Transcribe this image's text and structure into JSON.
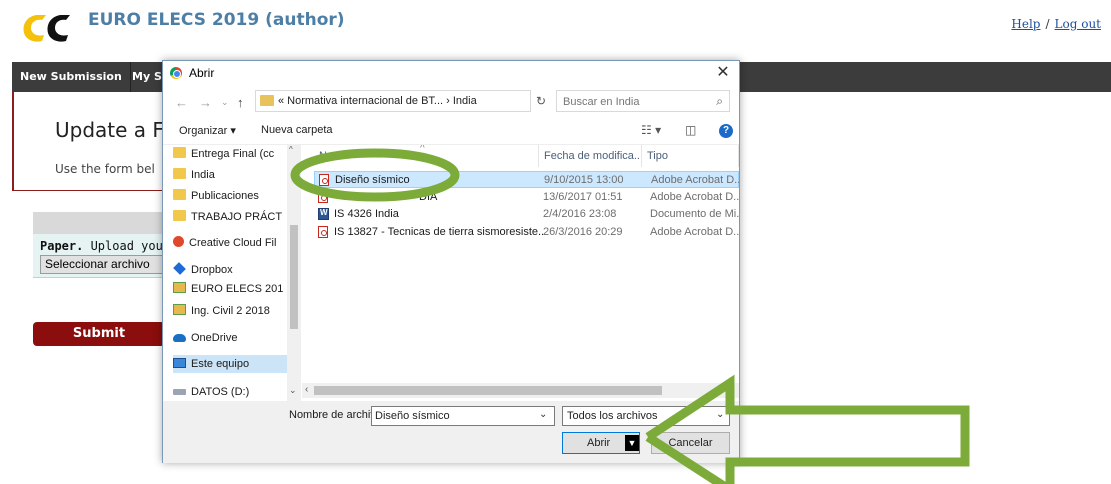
{
  "app": {
    "title": "EURO ELECS 2019 (author)",
    "help_link": "Help",
    "separator": "/",
    "logout_link": "Log out"
  },
  "navbar": {
    "items": [
      "New Submission",
      "My S"
    ]
  },
  "page": {
    "heading": "Update a F",
    "description": "Use the form bel",
    "paper_label_bold": "Paper.",
    "paper_label_rest": " Upload you",
    "file_button": "Seleccionar archivo",
    "submit_button": "Submit"
  },
  "dialog": {
    "title": "Abrir",
    "close": "✕",
    "address": "« Normativa internacional de BT...  ›  India",
    "search_placeholder": "Buscar en India",
    "toolbar": {
      "organize": "Organizar ▾",
      "new_folder": "Nueva carpeta",
      "view_icons": "☷ ▾",
      "pane_icon": "◫",
      "help_icon": "?"
    },
    "nav_items": [
      {
        "label": "Entrega Final (cc",
        "icon": "folder-icon"
      },
      {
        "label": "India",
        "icon": "folder-icon"
      },
      {
        "label": "Publicaciones",
        "icon": "folder-icon"
      },
      {
        "label": "TRABAJO PRÁCT",
        "icon": "folder-icon"
      },
      {
        "label": "Creative Cloud Fil",
        "icon": "creative-cloud-icon"
      },
      {
        "label": "Dropbox",
        "icon": "dropbox-icon"
      },
      {
        "label": "EURO ELECS 201",
        "icon": "shared-folder-icon"
      },
      {
        "label": "Ing. Civil 2 2018",
        "icon": "shared-folder-icon"
      },
      {
        "label": "OneDrive",
        "icon": "onedrive-icon"
      },
      {
        "label": "Este equipo",
        "icon": "computer-icon"
      },
      {
        "label": "DATOS (D:)",
        "icon": "drive-icon"
      }
    ],
    "columns": {
      "name": "N",
      "date": "Fecha de modifica...",
      "type": "Tipo"
    },
    "files": [
      {
        "name": "Diseño sísmico",
        "date": "9/10/2015 13:00",
        "type": "Adobe Acrobat D...",
        "icon": "pdf-icon"
      },
      {
        "name": "DIA",
        "date": "13/6/2017 01:51",
        "type": "Adobe Acrobat D...",
        "icon": "pdf-icon"
      },
      {
        "name": "IS 4326 India",
        "date": "2/4/2016 23:08",
        "type": "Documento de Mi...",
        "icon": "word-icon"
      },
      {
        "name": "IS 13827 - Tecnicas de tierra sismoresiste...",
        "date": "26/3/2016 20:29",
        "type": "Adobe Acrobat D...",
        "icon": "pdf-icon"
      }
    ],
    "filename_label": "Nombre de archivo:",
    "filename_value": "Diseño sísmico",
    "filetype_value": "Todos los archivos",
    "open_button": "Abrir",
    "cancel_button": "Cancelar"
  },
  "annotation": {
    "color": "#7cab3a"
  }
}
